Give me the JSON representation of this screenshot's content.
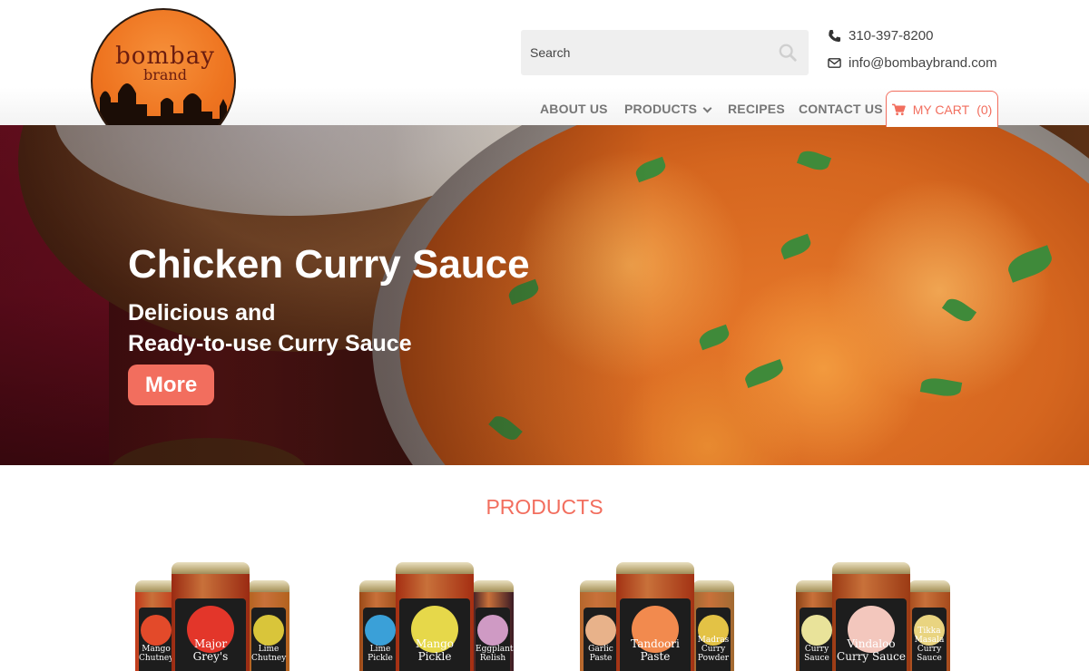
{
  "brand": {
    "logo_line1": "bombay",
    "logo_line2": "brand"
  },
  "search": {
    "placeholder": "Search"
  },
  "contact": {
    "phone": "310-397-8200",
    "email": "info@bombaybrand.com"
  },
  "nav": {
    "items": [
      {
        "label": "ABOUT US"
      },
      {
        "label": "PRODUCTS"
      },
      {
        "label": "RECIPES"
      },
      {
        "label": "CONTACT US"
      }
    ],
    "cart_label": "MY CART",
    "cart_count": "(0)"
  },
  "hero": {
    "title": "Chicken Curry Sauce",
    "subtitle_line1": "Delicious and",
    "subtitle_line2": "Ready-to-use Curry Sauce",
    "button_label": "More"
  },
  "products": {
    "heading": "PRODUCTS",
    "groups": [
      {
        "jars": [
          {
            "name": "Mango Chutney",
            "color": "#c23a1c",
            "accent": "#e34a2a"
          },
          {
            "name": "Major Grey's",
            "color": "#9a2a12",
            "accent": "#e3362a"
          },
          {
            "name": "Lime Chutney",
            "color": "#b3621e",
            "accent": "#d9c53a"
          }
        ]
      },
      {
        "jars": [
          {
            "name": "Lime Pickle",
            "color": "#9b4a18",
            "accent": "#3aa0d8"
          },
          {
            "name": "Mango Pickle",
            "color": "#a52e12",
            "accent": "#e6d84a"
          },
          {
            "name": "Eggplant Relish",
            "color": "#3a1a24",
            "accent": "#cf9ac4"
          }
        ]
      },
      {
        "jars": [
          {
            "name": "Garlic Paste",
            "color": "#b5672c",
            "accent": "#e8b28a"
          },
          {
            "name": "Tandoori Paste",
            "color": "#a33214",
            "accent": "#f28a4e"
          },
          {
            "name": "Madras Curry Powder",
            "color": "#a26a32",
            "accent": "#e3c245"
          }
        ]
      },
      {
        "jars": [
          {
            "name": "Curry Sauce",
            "color": "#8e4418",
            "accent": "#e9e39a"
          },
          {
            "name": "Vindaloo Curry Sauce",
            "color": "#9b3a14",
            "accent": "#f3c7bd"
          },
          {
            "name": "Tikka Masala Curry Sauce",
            "color": "#a54a1c",
            "accent": "#e9d480"
          }
        ]
      }
    ]
  }
}
